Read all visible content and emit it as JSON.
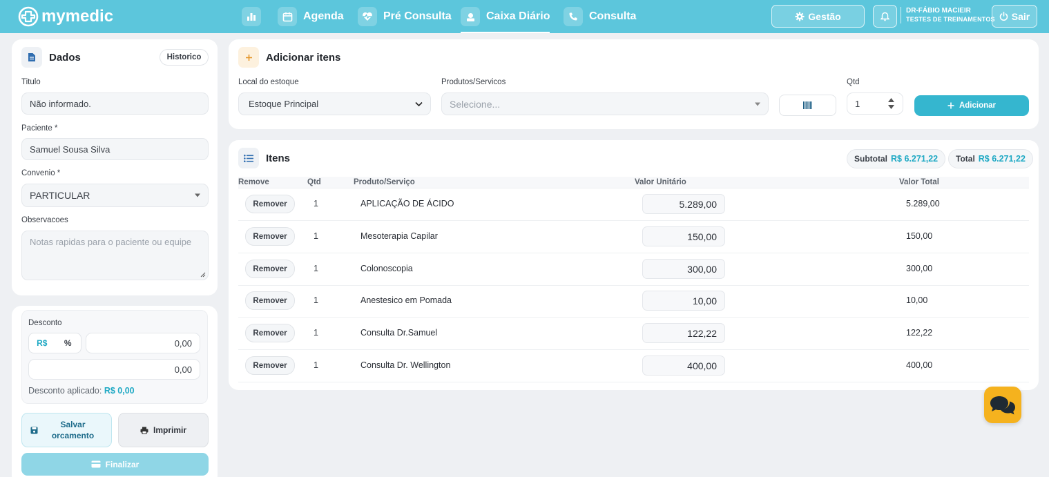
{
  "header": {
    "logo_text": "mymedic",
    "nav": [
      {
        "label": ""
      },
      {
        "label": "Agenda"
      },
      {
        "label": "Pré Consulta"
      },
      {
        "label": "Caixa Diário"
      },
      {
        "label": "Consulta"
      }
    ],
    "gestao_label": "Gestão",
    "user_name": "DR-FÁBIO MACIEIR",
    "user_subtitle": "TESTES DE TREINAMENTOS",
    "sair_label": "Sair",
    "accent_color": "#5cc6dc"
  },
  "dados": {
    "title": "Dados",
    "historico_label": "Historico",
    "titulo_label": "Titulo",
    "titulo_value": "Não informado.",
    "paciente_label": "Paciente *",
    "paciente_value": "Samuel Sousa Silva",
    "convenio_label": "Convenio *",
    "convenio_value": "PARTICULAR",
    "observacoes_label": "Observacoes",
    "observacoes_placeholder": "Notas rapidas para o paciente ou equipe"
  },
  "desconto": {
    "label": "Desconto",
    "mode_currency": "R$",
    "mode_percent": "%",
    "value1": "0,00",
    "value2": "0,00",
    "aplicado_label": "Desconto aplicado:",
    "aplicado_value": "R$ 0,00"
  },
  "actions": {
    "salvar_orcamento": "Salvar orcamento",
    "imprimir": "Imprimir",
    "finalizar": "Finalizar"
  },
  "adicionar": {
    "title": "Adicionar itens",
    "local_label": "Local do estoque",
    "local_value": "Estoque Principal",
    "produtos_label": "Produtos/Servicos",
    "produtos_placeholder": "Selecione...",
    "qtd_label": "Qtd",
    "qtd_value": "1",
    "adicionar_label": "Adicionar"
  },
  "itens": {
    "title": "Itens",
    "subtotal_label": "Subtotal",
    "subtotal_value": "R$ 6.271,22",
    "total_label": "Total",
    "total_value": "R$ 6.271,22",
    "columns": {
      "remove": "Remove",
      "qtd": "Qtd",
      "produto": "Produto/Serviço",
      "valor_unitario": "Valor Unitário",
      "valor_total": "Valor Total"
    },
    "remove_label": "Remover",
    "rows": [
      {
        "qtd": "1",
        "produto": "APLICAÇÃO DE ÁCIDO",
        "valor_unitario": "5.289,00",
        "valor_total": "5.289,00"
      },
      {
        "qtd": "1",
        "produto": "Mesoterapia Capilar",
        "valor_unitario": "150,00",
        "valor_total": "150,00"
      },
      {
        "qtd": "1",
        "produto": "Colonoscopia",
        "valor_unitario": "300,00",
        "valor_total": "300,00"
      },
      {
        "qtd": "1",
        "produto": "Anestesico em Pomada",
        "valor_unitario": "10,00",
        "valor_total": "10,00"
      },
      {
        "qtd": "1",
        "produto": "Consulta Dr.Samuel",
        "valor_unitario": "122,22",
        "valor_total": "122,22"
      },
      {
        "qtd": "1",
        "produto": "Consulta Dr. Wellington",
        "valor_unitario": "400,00",
        "valor_total": "400,00"
      }
    ]
  }
}
